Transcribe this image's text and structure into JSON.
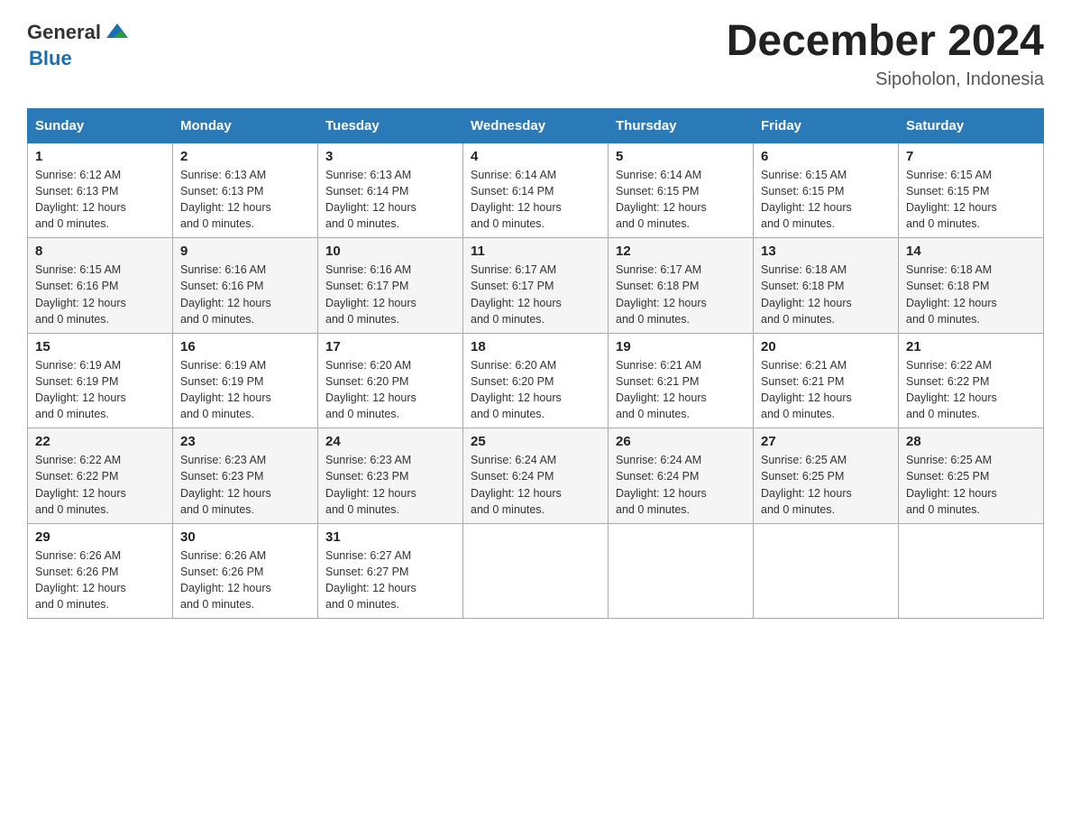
{
  "header": {
    "logo_general": "General",
    "logo_blue": "Blue",
    "month_title": "December 2024",
    "location": "Sipoholon, Indonesia"
  },
  "days_of_week": [
    "Sunday",
    "Monday",
    "Tuesday",
    "Wednesday",
    "Thursday",
    "Friday",
    "Saturday"
  ],
  "weeks": [
    [
      {
        "day": "1",
        "sunrise": "6:12 AM",
        "sunset": "6:13 PM",
        "daylight": "12 hours and 0 minutes."
      },
      {
        "day": "2",
        "sunrise": "6:13 AM",
        "sunset": "6:13 PM",
        "daylight": "12 hours and 0 minutes."
      },
      {
        "day": "3",
        "sunrise": "6:13 AM",
        "sunset": "6:14 PM",
        "daylight": "12 hours and 0 minutes."
      },
      {
        "day": "4",
        "sunrise": "6:14 AM",
        "sunset": "6:14 PM",
        "daylight": "12 hours and 0 minutes."
      },
      {
        "day": "5",
        "sunrise": "6:14 AM",
        "sunset": "6:15 PM",
        "daylight": "12 hours and 0 minutes."
      },
      {
        "day": "6",
        "sunrise": "6:15 AM",
        "sunset": "6:15 PM",
        "daylight": "12 hours and 0 minutes."
      },
      {
        "day": "7",
        "sunrise": "6:15 AM",
        "sunset": "6:15 PM",
        "daylight": "12 hours and 0 minutes."
      }
    ],
    [
      {
        "day": "8",
        "sunrise": "6:15 AM",
        "sunset": "6:16 PM",
        "daylight": "12 hours and 0 minutes."
      },
      {
        "day": "9",
        "sunrise": "6:16 AM",
        "sunset": "6:16 PM",
        "daylight": "12 hours and 0 minutes."
      },
      {
        "day": "10",
        "sunrise": "6:16 AM",
        "sunset": "6:17 PM",
        "daylight": "12 hours and 0 minutes."
      },
      {
        "day": "11",
        "sunrise": "6:17 AM",
        "sunset": "6:17 PM",
        "daylight": "12 hours and 0 minutes."
      },
      {
        "day": "12",
        "sunrise": "6:17 AM",
        "sunset": "6:18 PM",
        "daylight": "12 hours and 0 minutes."
      },
      {
        "day": "13",
        "sunrise": "6:18 AM",
        "sunset": "6:18 PM",
        "daylight": "12 hours and 0 minutes."
      },
      {
        "day": "14",
        "sunrise": "6:18 AM",
        "sunset": "6:18 PM",
        "daylight": "12 hours and 0 minutes."
      }
    ],
    [
      {
        "day": "15",
        "sunrise": "6:19 AM",
        "sunset": "6:19 PM",
        "daylight": "12 hours and 0 minutes."
      },
      {
        "day": "16",
        "sunrise": "6:19 AM",
        "sunset": "6:19 PM",
        "daylight": "12 hours and 0 minutes."
      },
      {
        "day": "17",
        "sunrise": "6:20 AM",
        "sunset": "6:20 PM",
        "daylight": "12 hours and 0 minutes."
      },
      {
        "day": "18",
        "sunrise": "6:20 AM",
        "sunset": "6:20 PM",
        "daylight": "12 hours and 0 minutes."
      },
      {
        "day": "19",
        "sunrise": "6:21 AM",
        "sunset": "6:21 PM",
        "daylight": "12 hours and 0 minutes."
      },
      {
        "day": "20",
        "sunrise": "6:21 AM",
        "sunset": "6:21 PM",
        "daylight": "12 hours and 0 minutes."
      },
      {
        "day": "21",
        "sunrise": "6:22 AM",
        "sunset": "6:22 PM",
        "daylight": "12 hours and 0 minutes."
      }
    ],
    [
      {
        "day": "22",
        "sunrise": "6:22 AM",
        "sunset": "6:22 PM",
        "daylight": "12 hours and 0 minutes."
      },
      {
        "day": "23",
        "sunrise": "6:23 AM",
        "sunset": "6:23 PM",
        "daylight": "12 hours and 0 minutes."
      },
      {
        "day": "24",
        "sunrise": "6:23 AM",
        "sunset": "6:23 PM",
        "daylight": "12 hours and 0 minutes."
      },
      {
        "day": "25",
        "sunrise": "6:24 AM",
        "sunset": "6:24 PM",
        "daylight": "12 hours and 0 minutes."
      },
      {
        "day": "26",
        "sunrise": "6:24 AM",
        "sunset": "6:24 PM",
        "daylight": "12 hours and 0 minutes."
      },
      {
        "day": "27",
        "sunrise": "6:25 AM",
        "sunset": "6:25 PM",
        "daylight": "12 hours and 0 minutes."
      },
      {
        "day": "28",
        "sunrise": "6:25 AM",
        "sunset": "6:25 PM",
        "daylight": "12 hours and 0 minutes."
      }
    ],
    [
      {
        "day": "29",
        "sunrise": "6:26 AM",
        "sunset": "6:26 PM",
        "daylight": "12 hours and 0 minutes."
      },
      {
        "day": "30",
        "sunrise": "6:26 AM",
        "sunset": "6:26 PM",
        "daylight": "12 hours and 0 minutes."
      },
      {
        "day": "31",
        "sunrise": "6:27 AM",
        "sunset": "6:27 PM",
        "daylight": "12 hours and 0 minutes."
      },
      null,
      null,
      null,
      null
    ]
  ]
}
